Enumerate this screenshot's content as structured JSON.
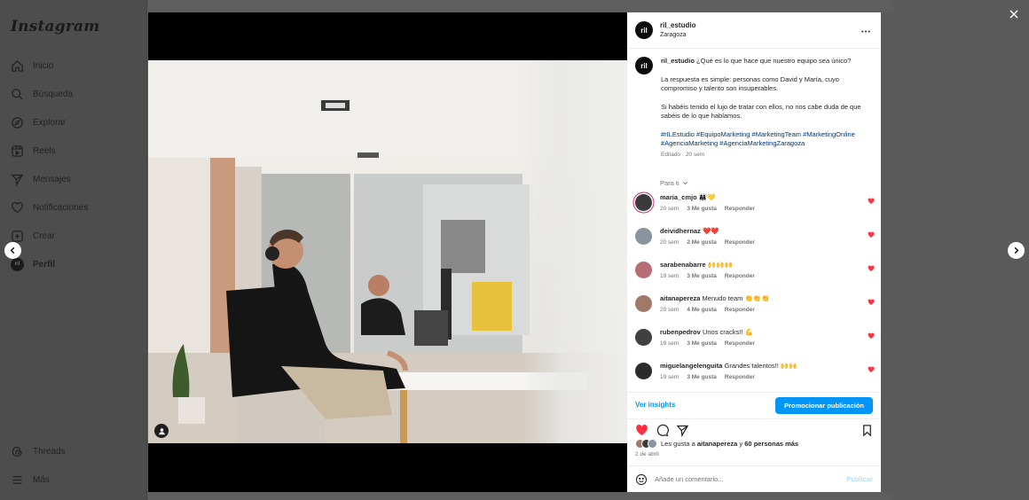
{
  "app": {
    "logo": "Instagram"
  },
  "nav": {
    "items": [
      {
        "label": "Inicio",
        "icon": "home-icon"
      },
      {
        "label": "Búsqueda",
        "icon": "search-icon"
      },
      {
        "label": "Explorar",
        "icon": "compass-icon"
      },
      {
        "label": "Reels",
        "icon": "reels-icon"
      },
      {
        "label": "Mensajes",
        "icon": "send-icon"
      },
      {
        "label": "Notificaciones",
        "icon": "heart-icon"
      },
      {
        "label": "Crear",
        "icon": "plus-square-icon"
      },
      {
        "label": "Perfil",
        "icon": "avatar"
      }
    ],
    "threads": "Threads",
    "more": "Más",
    "profile_avatar_text": "ril"
  },
  "post": {
    "username": "ril_estudio",
    "location": "Zaragoza",
    "avatar_text": "ril",
    "caption": {
      "username": "ril_estudio",
      "line1": "¿Qué es lo que hace que nuestro equipo sea único?",
      "para2": "La respuesta es simple: personas como David y María, cuyo compromiso y talento son insuperables.",
      "para3": "Si habéis tenido el lujo de tratar con ellos, no nos cabe duda de que sabéis de lo que hablamos.",
      "hashtags": "#rILEstudio #EquipoMarketing #MarketingTeam #MarketingOnline #AgenciaMarketing #AgenciaMarketingZaragoza",
      "meta": "Editado · 20 sem"
    },
    "filter_label": "Para ti",
    "comments": [
      {
        "user": "maria_cmjo",
        "text": "👩‍👩‍👧💛",
        "time": "20 sem",
        "likes": "3 Me gusta",
        "reply": "Responder",
        "avatar_color": "#3a3a3a",
        "story_ring": true
      },
      {
        "user": "deividhernaz",
        "text": "❤️❤️",
        "time": "20 sem",
        "likes": "2 Me gusta",
        "reply": "Responder",
        "avatar_color": "#8a94a0",
        "story_ring": false
      },
      {
        "user": "sarabenabarre",
        "text": "🙌🙌🙌",
        "time": "19 sem",
        "likes": "3 Me gusta",
        "reply": "Responder",
        "avatar_color": "#b86d75",
        "story_ring": false
      },
      {
        "user": "aitanapereza",
        "text": "Menudo team 👏👏👏",
        "time": "20 sem",
        "likes": "4 Me gusta",
        "reply": "Responder",
        "avatar_color": "#a07a68",
        "story_ring": false
      },
      {
        "user": "rubenpedrov",
        "text": "Unos cracks!! 💪",
        "time": "19 sem",
        "likes": "3 Me gusta",
        "reply": "Responder",
        "avatar_color": "#404040",
        "story_ring": false
      },
      {
        "user": "miguelangelenguita",
        "text": "Grandes talentos!! 🙌🙌",
        "time": "19 sem",
        "likes": "3 Me gusta",
        "reply": "Responder",
        "avatar_color": "#2b2b2b",
        "story_ring": false
      }
    ],
    "insights_label": "Ver insights",
    "promote_label": "Promocionar publicación",
    "likes": {
      "prefix": "Les gusta a",
      "user": "aitanapereza",
      "mid": "y",
      "others": "60 personas más"
    },
    "date": "2 de abril",
    "comment_placeholder": "Añade un comentario...",
    "publish_label": "Publicar"
  },
  "colors": {
    "accent": "#0095f6",
    "like_red": "#ff3040",
    "overlay": "#5a5a5a"
  }
}
